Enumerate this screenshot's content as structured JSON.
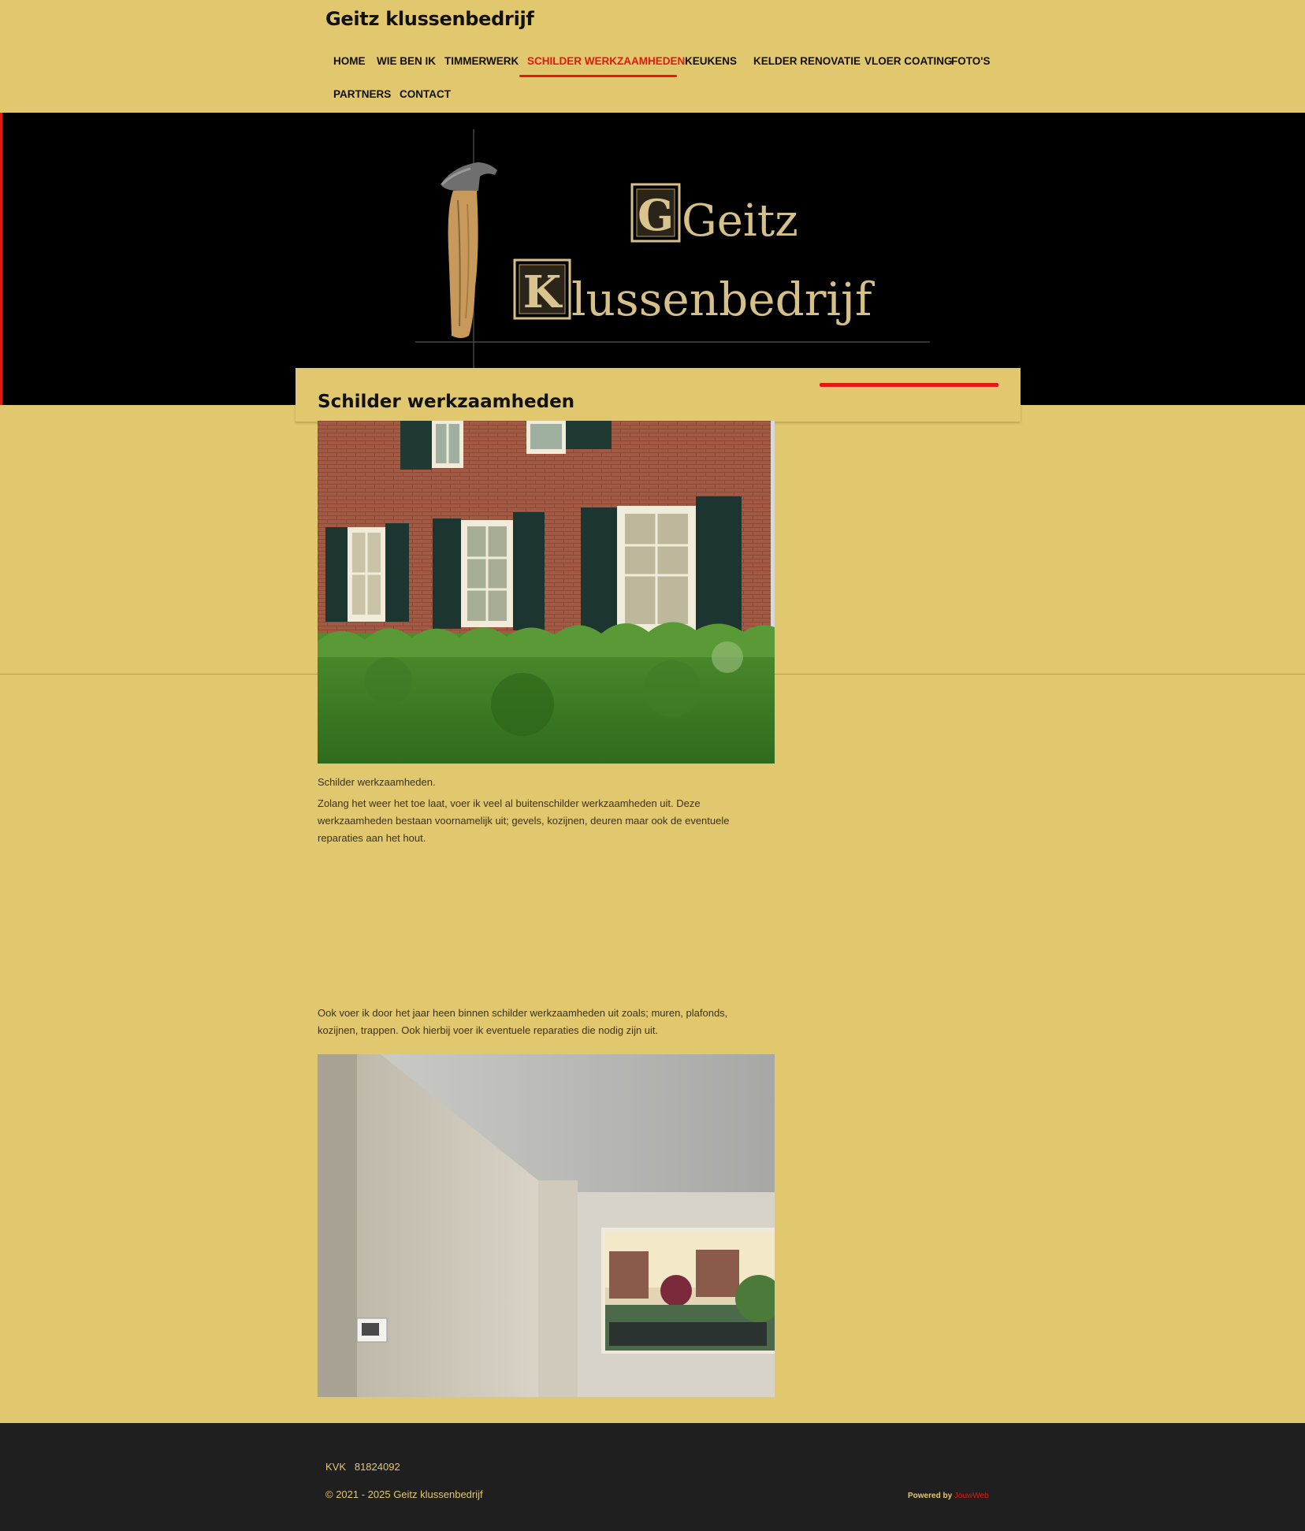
{
  "header": {
    "site_title": "Geitz klussenbedrijf"
  },
  "nav": {
    "items": [
      {
        "label": "HOME"
      },
      {
        "label": "WIE BEN IK"
      },
      {
        "label": "TIMMERWERK"
      },
      {
        "label": "SCHILDER WERKZAAMHEDEN",
        "active": true
      },
      {
        "label": "KEUKENS"
      },
      {
        "label": "KELDER RENOVATIE"
      },
      {
        "label": "VLOER COATING"
      },
      {
        "label": "FOTO'S"
      },
      {
        "label": "PARTNERS"
      },
      {
        "label": "CONTACT"
      }
    ]
  },
  "hero": {
    "logo_line1": "Geitz",
    "logo_line2": "Klussenbedrijf"
  },
  "main": {
    "page_title": "Schilder werkzaamheden",
    "caption": "Schilder werkzaamheden.",
    "paragraph1": "Zolang het weer het toe laat, voer ik veel al buitenschilder werkzaamheden uit. Deze werkzaamheden bestaan voornamelijk uit; gevels, kozijnen, deuren maar ook de eventuele reparaties aan het hout.",
    "paragraph2": "Ook voer ik door het jaar heen binnen schilder werkzaamheden uit zoals; muren, plafonds, kozijnen, trappen. Ook hierbij voer ik eventuele reparaties die nodig zijn uit."
  },
  "footer": {
    "kvk": "KVK   81824092",
    "copyright": "© 2021 - 2025 Geitz klussenbedrijf",
    "powered_prefix": "Powered by ",
    "powered_brand": "JouwWeb"
  },
  "colors": {
    "background": "#e1c76e",
    "accent": "#e01b13",
    "footer": "#1f1f1f",
    "hero": "#000000"
  }
}
